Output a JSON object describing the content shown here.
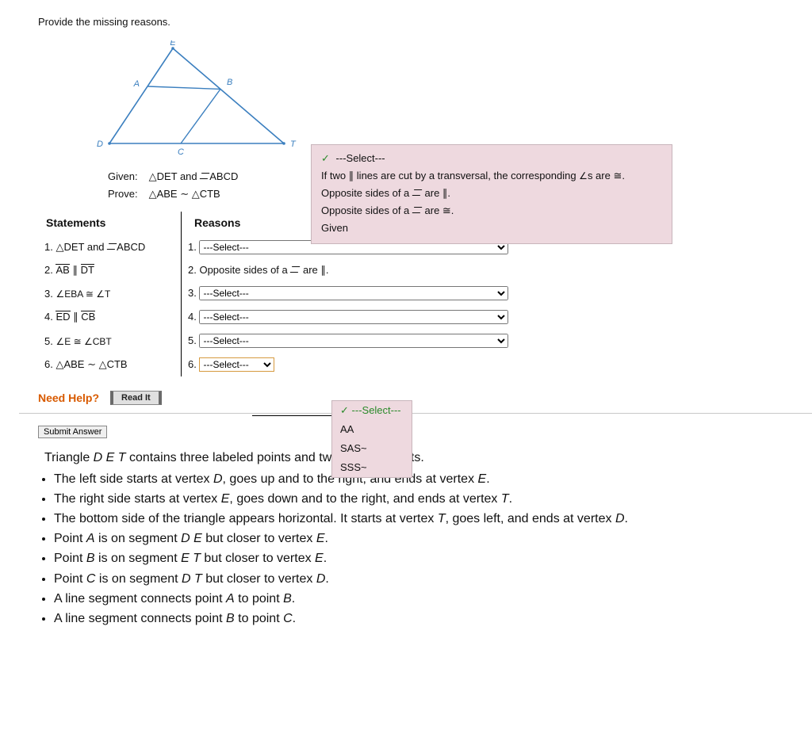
{
  "prompt": "Provide the missing reasons.",
  "figure": {
    "label_E": "E",
    "label_A": "A",
    "label_B": "B",
    "label_D": "D",
    "label_C": "C",
    "label_T": "T"
  },
  "given_prove": {
    "given_label": "Given:",
    "given_text_prefix": "△DET and ",
    "given_text_suffix": "ABCD",
    "prove_label": "Prove:",
    "prove_text": "△ABE ∼ △CTB"
  },
  "headers": {
    "statements": "Statements",
    "reasons": "Reasons"
  },
  "rows": {
    "r1": {
      "num_s": "1.",
      "statement_prefix": "△DET and ",
      "statement_suffix": "ABCD",
      "num_r": "1.",
      "reason_select": "---Select---"
    },
    "r2": {
      "num_s": "2.",
      "seg1": "AB",
      "seg2": "DT",
      "num_r": "2.",
      "reason_text_prefix": "Opposite sides of a ",
      "reason_text_suffix": " are ∥."
    },
    "r3": {
      "num_s": "3.",
      "statement": "∠EBA ≅ ∠T",
      "num_r": "3.",
      "reason_select": "---Select---"
    },
    "r4": {
      "num_s": "4.",
      "seg1": "ED",
      "seg2": "CB",
      "num_r": "4.",
      "reason_select": "---Select---"
    },
    "r5": {
      "num_s": "5.",
      "statement": "∠E ≅ ∠CBT",
      "num_r": "5.",
      "reason_select": "---Select---"
    },
    "r6": {
      "num_s": "6.",
      "statement": "△ABE ∼ △CTB",
      "num_r": "6.",
      "reason_select": "---Select---"
    }
  },
  "reason_options_panel": {
    "selected": "---Select---",
    "opt1_prefix": "If two ∥ lines are cut by a transversal, the corresponding ",
    "opt1_suffix": "s are ≅.",
    "opt2_prefix": "Opposite sides of a ",
    "opt2_suffix": " are ∥.",
    "opt3_prefix": "Opposite sides of a ",
    "opt3_suffix": " are ≅.",
    "opt4": "Given"
  },
  "row6_options": {
    "selected": "---Select---",
    "opt1": "AA",
    "opt2": "SAS~",
    "opt3": "SSS~"
  },
  "need_help": {
    "label": "Need Help?",
    "read_it": "Read It"
  },
  "submit": "Submit Answer",
  "description": {
    "intro_prefix": "Triangle ",
    "intro_letters": "D E T",
    "intro_suffix": " contains three labeled points and two line segments.",
    "items": [
      "The left side starts at vertex D, goes up and to the right, and ends at vertex E.",
      "The right side starts at vertex E, goes down and to the right, and ends at vertex T.",
      "The bottom side of the triangle appears horizontal. It starts at vertex T, goes left, and ends at vertex D.",
      "Point A is on segment D E but closer to vertex E.",
      "Point B is on segment E T but closer to vertex E.",
      "Point C is on segment D T but closer to vertex D.",
      "A line segment connects point A to point B.",
      "A line segment connects point B to point C."
    ]
  }
}
